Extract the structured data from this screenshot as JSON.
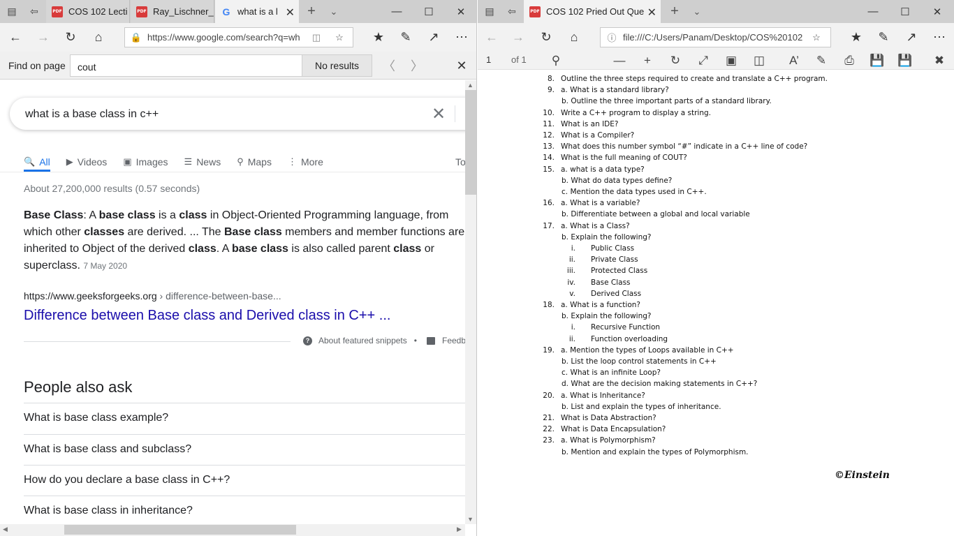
{
  "left": {
    "tabs": [
      {
        "label": "COS 102 Lecti",
        "type": "pdf"
      },
      {
        "label": "Ray_Lischner_",
        "type": "pdf"
      },
      {
        "label": "what is a l",
        "type": "google"
      }
    ],
    "url": "https://www.google.com/search?q=wh",
    "find": {
      "label": "Find on page",
      "value": "cout",
      "result": "No results"
    },
    "search": {
      "query": "what is a base class in c++",
      "tabs": [
        "All",
        "Videos",
        "Images",
        "News",
        "Maps",
        "More"
      ],
      "tools_label": "To",
      "stats": "About 27,200,000 results (0.57 seconds)",
      "snippet_date": "7 May 2020",
      "cite_domain": "https://www.geeksforgeeks.org",
      "cite_path": " › difference-between-base...",
      "result_title": "Difference between Base class and Derived class in C++ ...",
      "about_snippets": "About featured snippets",
      "bullet": "•",
      "feedback": "Feedb",
      "paa_title": "People also ask",
      "paa": [
        "What is base class example?",
        "What is base class and subclass?",
        "How do you declare a base class in C++?",
        "What is base class in inheritance?"
      ]
    },
    "snippet_parts": [
      [
        "b",
        "Base Class"
      ],
      [
        "t",
        ": A "
      ],
      [
        "b",
        "base class"
      ],
      [
        "t",
        " is a "
      ],
      [
        "b",
        "class"
      ],
      [
        "t",
        " in Object-Oriented Programming language, from which other "
      ],
      [
        "b",
        "classes"
      ],
      [
        "t",
        " are derived. ... The "
      ],
      [
        "b",
        "Base class"
      ],
      [
        "t",
        " members and member functions are inherited to Object of the derived "
      ],
      [
        "b",
        "class"
      ],
      [
        "t",
        ". A "
      ],
      [
        "b",
        "base class"
      ],
      [
        "t",
        " is also called parent "
      ],
      [
        "b",
        "class"
      ],
      [
        "t",
        " or superclass. "
      ]
    ]
  },
  "right": {
    "tab": {
      "label": "COS 102 Pried Out Que",
      "type": "pdf"
    },
    "url": "file:///C:/Users/Panam/Desktop/COS%20102",
    "page": "1",
    "page_of": "of 1",
    "lines": [
      {
        "n": "8.",
        "t": "Outline the three steps required to create and translate a C++ program."
      },
      {
        "n": "9.",
        "t": "a.  What is a standard library?"
      },
      {
        "n": "",
        "t": "b. Outline the three important parts of a standard library.",
        "indent": 1
      },
      {
        "n": "10.",
        "t": "Write a C++ program to display a string."
      },
      {
        "n": "11.",
        "t": "What is an IDE?"
      },
      {
        "n": "12.",
        "t": "What is a Compiler?"
      },
      {
        "n": "13.",
        "t": "What does this number symbol “#” indicate in a C++ line of code?"
      },
      {
        "n": "14.",
        "t": "What is the full meaning of COUT?"
      },
      {
        "n": "15.",
        "t": "a.  what is a data type?"
      },
      {
        "n": "",
        "t": "b. What do data types define?",
        "indent": 1
      },
      {
        "n": "",
        "t": "c. Mention the data types used in C++.",
        "indent": 1
      },
      {
        "n": "16.",
        "t": "a.  What is a variable?"
      },
      {
        "n": "",
        "t": "b. Differentiate between a global and local variable",
        "indent": 1
      },
      {
        "n": "17.",
        "t": "a.  What is a Class?"
      },
      {
        "n": "",
        "t": "b. Explain the following?",
        "indent": 1
      },
      {
        "n": "i.",
        "t": "Public Class",
        "indent": 2
      },
      {
        "n": "ii.",
        "t": "Private Class",
        "indent": 2
      },
      {
        "n": "iii.",
        "t": "Protected Class",
        "indent": 2
      },
      {
        "n": "iv.",
        "t": "Base Class",
        "indent": 2
      },
      {
        "n": "v.",
        "t": "Derived Class",
        "indent": 2
      },
      {
        "n": "18.",
        "t": "a.  What is a function?"
      },
      {
        "n": "",
        "t": "b. Explain the following?",
        "indent": 1
      },
      {
        "n": "i.",
        "t": "Recursive Function",
        "indent": 2
      },
      {
        "n": "ii.",
        "t": "Function overloading",
        "indent": 2
      },
      {
        "n": "19.",
        "t": "a.  Mention the types of Loops available in C++"
      },
      {
        "n": "",
        "t": "b. List the loop control statements in C++",
        "indent": 1
      },
      {
        "n": "",
        "t": "c. What is an infinite Loop?",
        "indent": 1
      },
      {
        "n": "",
        "t": "d. What are the decision making statements in C++?",
        "indent": 1
      },
      {
        "n": "20.",
        "t": "a.  What is Inheritance?"
      },
      {
        "n": "",
        "t": "b. List and explain the types of inheritance.",
        "indent": 1
      },
      {
        "n": "21.",
        "t": "What is Data Abstraction?"
      },
      {
        "n": "22.",
        "t": "What is Data Encapsulation?"
      },
      {
        "n": "23.",
        "t": "a.  What is Polymorphism?"
      },
      {
        "n": "",
        "t": "b. Mention and explain the types of Polymorphism.",
        "indent": 1
      }
    ],
    "signature": "©Einstein"
  }
}
